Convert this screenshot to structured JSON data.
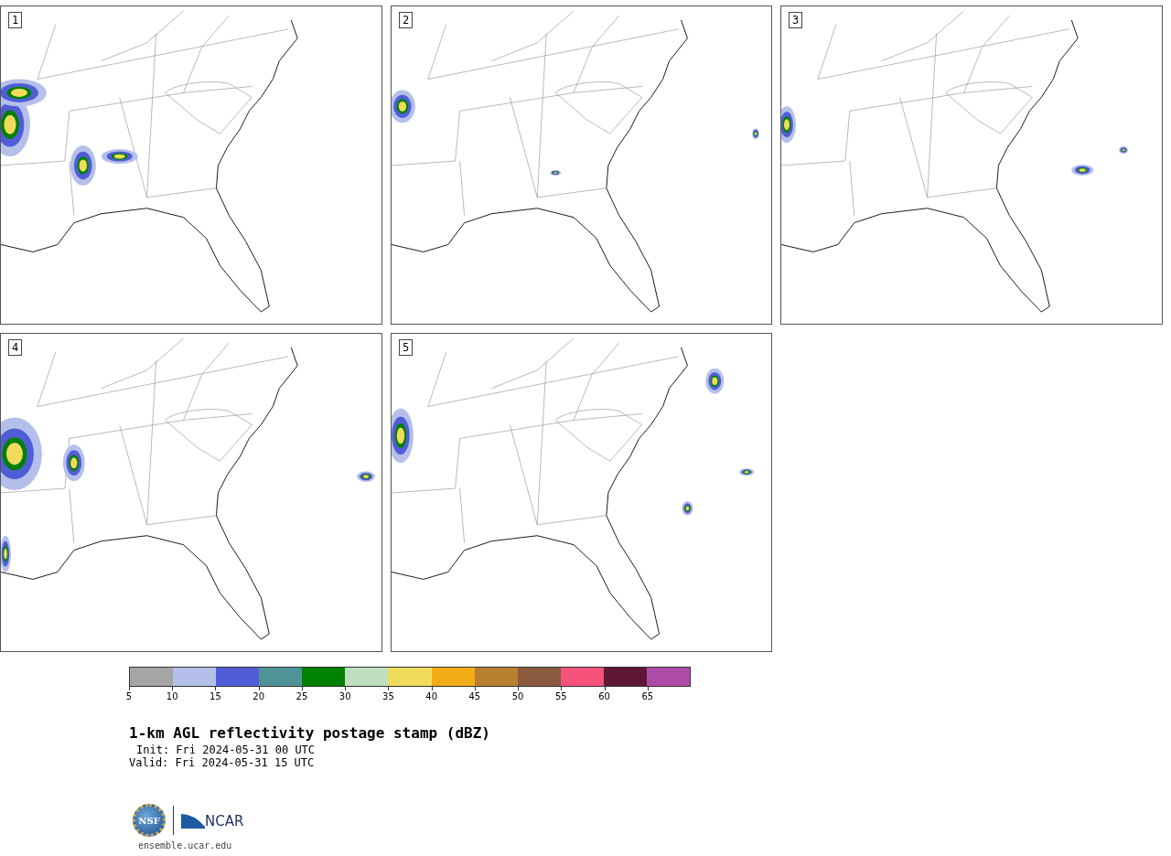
{
  "panels": [
    {
      "label": "1"
    },
    {
      "label": "2"
    },
    {
      "label": "3"
    },
    {
      "label": "4"
    },
    {
      "label": "5"
    }
  ],
  "colorbar": {
    "bins": [
      {
        "color": "#a5a5a5"
      },
      {
        "color": "#b4c0ea"
      },
      {
        "color": "#515dd6"
      },
      {
        "color": "#4f9399"
      },
      {
        "color": "#008000"
      },
      {
        "color": "#bddfbe"
      },
      {
        "color": "#f1db5d"
      },
      {
        "color": "#f1ac18"
      },
      {
        "color": "#b9812f"
      },
      {
        "color": "#8b5a3e"
      },
      {
        "color": "#f5527c"
      },
      {
        "color": "#5e1734"
      },
      {
        "color": "#ad4ca6"
      }
    ],
    "ticks": [
      "5",
      "10",
      "15",
      "20",
      "25",
      "30",
      "35",
      "40",
      "45",
      "50",
      "55",
      "60",
      "65"
    ]
  },
  "title": "1-km AGL reflectivity postage stamp (dBZ)",
  "init": "Init: Fri 2024-05-31 00 UTC",
  "valid": "Valid: Fri 2024-05-31 15 UTC",
  "logos": {
    "nsf": "NSF",
    "ncar": "NCAR"
  },
  "footer": "ensemble.ucar.edu"
}
